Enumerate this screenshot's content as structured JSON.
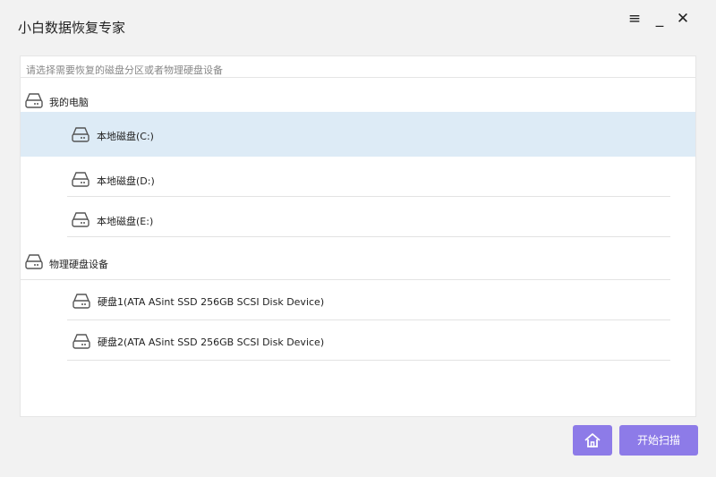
{
  "app": {
    "title": "小白数据恢复专家"
  },
  "window_controls": {
    "menu": "≡",
    "minimize": "_",
    "close": "✕"
  },
  "panel": {
    "hint": "请选择需要恢复的磁盘分区或者物理硬盘设备",
    "groups": [
      {
        "label": "我的电脑",
        "icon": "hard-drive-icon",
        "items": [
          {
            "label": "本地磁盘(C:)",
            "icon": "hard-drive-icon",
            "selected": true
          },
          {
            "label": "本地磁盘(D:)",
            "icon": "hard-drive-icon",
            "selected": false
          },
          {
            "label": "本地磁盘(E:)",
            "icon": "hard-drive-icon",
            "selected": false
          }
        ]
      },
      {
        "label": "物理硬盘设备",
        "icon": "hard-drive-icon",
        "items": [
          {
            "label": "硬盘1(ATA ASint SSD 256GB SCSI Disk Device)",
            "icon": "hard-drive-icon",
            "selected": false
          },
          {
            "label": "硬盘2(ATA ASint SSD 256GB SCSI Disk Device)",
            "icon": "hard-drive-icon",
            "selected": false
          }
        ]
      }
    ]
  },
  "footer": {
    "home_icon": "home-icon",
    "scan_label": "开始扫描"
  },
  "colors": {
    "accent": "#8d7be8",
    "selected_row": "#ddebf6",
    "background": "#f2f2f2"
  }
}
